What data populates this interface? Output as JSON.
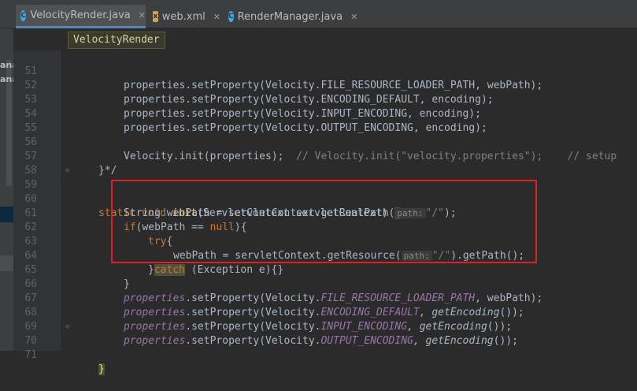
{
  "tabs": [
    {
      "label": "VelocityRender.java",
      "icon": "class-c-icon",
      "active": true
    },
    {
      "label": "web.xml",
      "icon": "xml-file-icon",
      "active": false
    },
    {
      "label": "RenderManager.java",
      "icon": "class-c-icon",
      "active": false
    }
  ],
  "breadcrumb": "VelocityRender",
  "left_panel": {
    "labels": [
      "ana",
      "ana"
    ]
  },
  "line_numbers": [
    "51",
    "52",
    "53",
    "54",
    "55",
    "56",
    "57",
    "58",
    "59",
    "60",
    "61",
    "62",
    "63",
    "64",
    "65",
    "66",
    "67",
    "68",
    "69",
    "70",
    "71"
  ],
  "hints": {
    "path": "path:"
  },
  "code": {
    "l51": {
      "a": "properties.setProperty(Velocity.FILE_RESOURCE_LOADER_PATH, webPath);"
    },
    "l52": {
      "a": "properties.setProperty(Velocity.ENCODING_DEFAULT, encoding);"
    },
    "l53": {
      "a": "properties.setProperty(Velocity.INPUT_ENCODING, encoding);"
    },
    "l54": {
      "a": "properties.setProperty(Velocity.OUTPUT_ENCODING, encoding);"
    },
    "l56": {
      "a": "Velocity.init(properties);  ",
      "b": "// Velocity.init(\"velocity.properties\");    // setup"
    },
    "l57": {
      "a": "}*/"
    },
    "l59": {
      "kw1": "static void ",
      "fn": "init",
      "a": "(ServletContext servletContext) ",
      "brace": "{"
    },
    "l60": {
      "a": "String webPath = servletContext.getRealPath(",
      "st": "\"/\"",
      "b": ");"
    },
    "l61": {
      "kw": "if",
      "a": "(webPath == ",
      "kw2": "null",
      "b": "){"
    },
    "l62": {
      "kw": "try",
      "a": "{"
    },
    "l63": {
      "a": "webPath = servletContext.getResource(",
      "st": "\"/\"",
      "b": ").getPath();"
    },
    "l64": {
      "a": "}",
      "kw": "catch",
      "b": " (Exception e){}"
    },
    "l65": {
      "a": "}"
    },
    "l66": {
      "p": "properties",
      "a": ".setProperty(Velocity.",
      "c": "FILE_RESOURCE_LOADER_PATH",
      "b": ", webPath);"
    },
    "l67": {
      "p": "properties",
      "a": ".setProperty(Velocity.",
      "c": "ENCODING_DEFAULT",
      "m": ", getEncoding",
      "b": "());"
    },
    "l68": {
      "p": "properties",
      "a": ".setProperty(Velocity.",
      "c": "INPUT_ENCODING",
      "m": ", getEncoding",
      "b": "());"
    },
    "l69": {
      "p": "properties",
      "a": ".setProperty(Velocity.",
      "c": "OUTPUT_ENCODING",
      "m": ", getEncoding",
      "b": "());"
    },
    "l70": {
      "brace": "}"
    }
  },
  "colors": {
    "highlight_box": "#e02020",
    "active_tab_underline": "#4a88c7"
  }
}
